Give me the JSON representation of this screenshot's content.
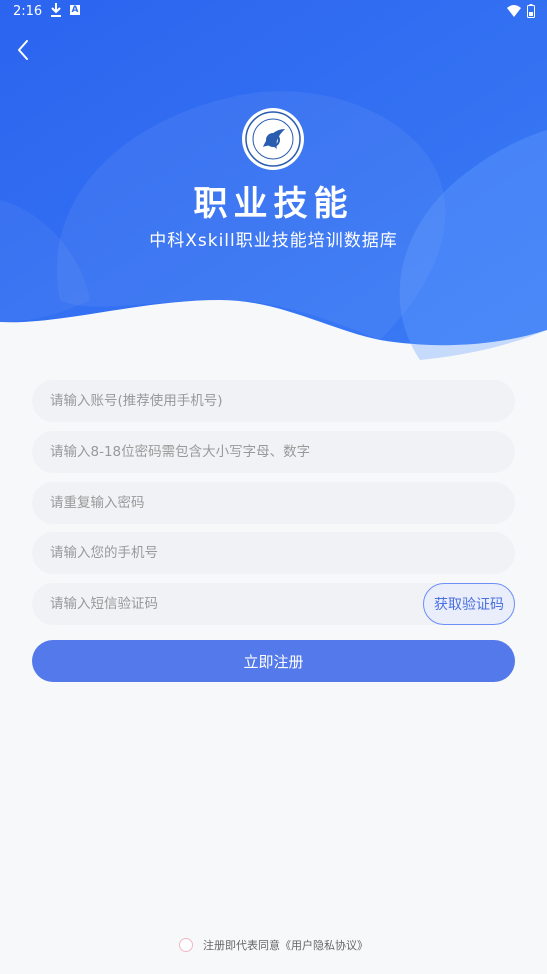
{
  "status_bar": {
    "time": "2:16",
    "download_icon": "download-icon",
    "app_icon": "A",
    "wifi_icon": "wifi-icon",
    "battery_icon": "battery-icon"
  },
  "header": {
    "back_icon": "chevron-left-icon",
    "logo_icon": "xskill-logo",
    "title": "职业技能",
    "subtitle": "中科Xskill职业技能培训数据库"
  },
  "form": {
    "account_placeholder": "请输入账号(推荐使用手机号)",
    "password_placeholder": "请输入8-18位密码需包含大小写字母、数字",
    "confirm_placeholder": "请重复输入密码",
    "phone_placeholder": "请输入您的手机号",
    "sms_placeholder": "请输入短信验证码",
    "get_code_label": "获取验证码",
    "submit_label": "立即注册"
  },
  "agreement": {
    "text": "注册即代表同意《用户隐私协议》"
  },
  "colors": {
    "header_blue": "#2f6cf0",
    "button_blue": "#5479ea",
    "background": "#f7f8fa"
  }
}
